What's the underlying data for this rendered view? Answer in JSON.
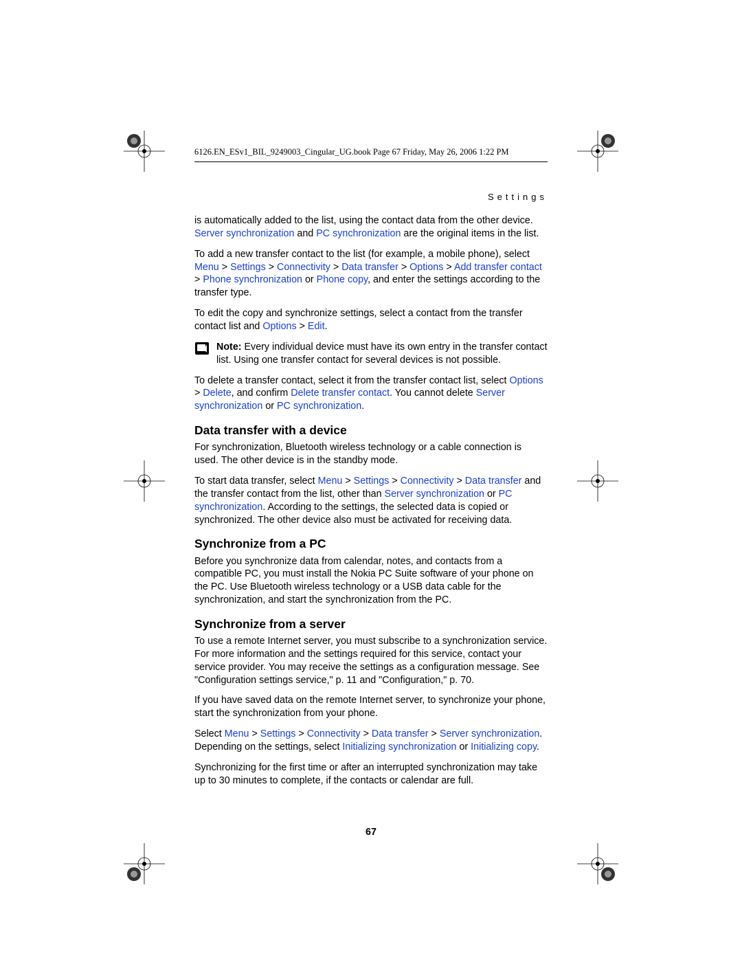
{
  "header": "6126.EN_ESv1_BIL_9249003_Cingular_UG.book  Page 67  Friday, May 26, 2006  1:22 PM",
  "section_label": "Settings",
  "page_number": "67",
  "p1a": "is automatically added to the list, using the contact data from the other device. ",
  "p1b": "Server synchronization",
  "p1c": " and ",
  "p1d": "PC synchronization",
  "p1e": " are the original items in the list.",
  "p2a": "To add a new transfer contact to the list (for example, a mobile phone), select ",
  "p2b": "Menu",
  "p2c": " > ",
  "p2d": "Settings",
  "p2e": " > ",
  "p2f": "Connectivity",
  "p2g": " > ",
  "p2h": "Data transfer",
  "p2i": " > ",
  "p2j": "Options",
  "p2k": " > ",
  "p2l": "Add transfer contact",
  "p2m": " > ",
  "p2n": "Phone synchronization",
  "p2o": " or ",
  "p2p": "Phone copy",
  "p2q": ", and enter the settings according to the transfer type.",
  "p3a": "To edit the copy and synchronize settings, select a contact from the transfer contact list and ",
  "p3b": "Options",
  "p3c": " > ",
  "p3d": "Edit",
  "p3e": ".",
  "note1a": "Note:",
  "note1b": " Every individual device must have its own entry in the transfer contact list. Using one transfer contact for several devices is not possible.",
  "p4a": "To delete a transfer contact, select it from the transfer contact list, select ",
  "p4b": "Options",
  "p4c": " > ",
  "p4d": "Delete",
  "p4e": ", and confirm ",
  "p4f": "Delete transfer contact",
  "p4g": ". You cannot delete ",
  "p4h": "Server synchronization",
  "p4i": " or ",
  "p4j": "PC synchronization",
  "p4k": ".",
  "h1": "Data transfer with a device",
  "p5": "For synchronization, Bluetooth wireless technology or a cable connection is used. The other device is in the standby mode.",
  "p6a": "To start data transfer, select ",
  "p6b": "Menu",
  "p6c": " > ",
  "p6d": "Settings",
  "p6e": " > ",
  "p6f": "Connectivity",
  "p6g": " > ",
  "p6h": "Data transfer",
  "p6i": " and the transfer contact from the list, other than ",
  "p6j": "Server synchronization",
  "p6k": " or ",
  "p6l": "PC synchronization",
  "p6m": ". According to the settings, the selected data is copied or synchronized. The other device also must be activated for receiving data.",
  "h2": "Synchronize from a PC",
  "p7": "Before you synchronize data from calendar, notes, and contacts from a compatible PC, you must install the Nokia PC Suite software of your phone on the PC. Use Bluetooth wireless technology or a USB data cable for the synchronization, and start the synchronization from the PC.",
  "h3": "Synchronize from a server",
  "p8": "To use a remote Internet server, you must subscribe to a synchronization service. For more information and the settings required for this service, contact your service provider. You may receive the settings as a configuration message. See \"Configuration settings service,\" p. 11 and \"Configuration,\" p. 70.",
  "p9": "If you have saved data on the remote Internet server, to synchronize your phone, start the synchronization from your phone.",
  "p10a": "Select ",
  "p10b": "Menu",
  "p10c": " > ",
  "p10d": "Settings",
  "p10e": " > ",
  "p10f": "Connectivity",
  "p10g": " > ",
  "p10h": "Data transfer",
  "p10i": " > ",
  "p10j": "Server synchronization",
  "p10k": ". Depending on the settings, select ",
  "p10l": "Initializing synchronization",
  "p10m": " or ",
  "p10n": "Initializing copy",
  "p10o": ".",
  "p11": "Synchronizing for the first time or after an interrupted synchronization may take up to 30 minutes to complete, if the contacts or calendar are full."
}
